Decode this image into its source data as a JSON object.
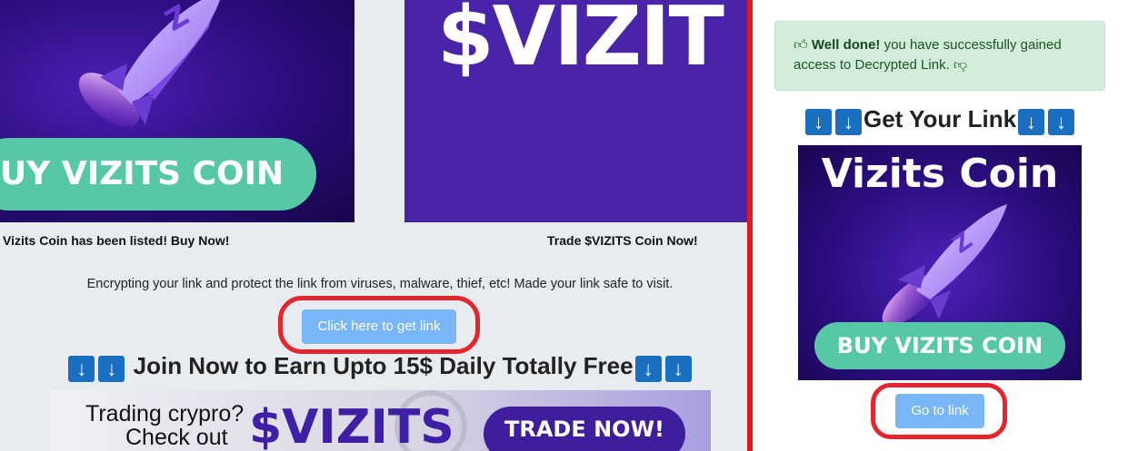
{
  "left": {
    "banner1": {
      "pill_label": "UY VIZITS COIN"
    },
    "banner2": {
      "logo_text": "$VIZIT"
    },
    "caption1": "Vizits Coin has been listed! Buy Now!",
    "caption2": "Trade $VIZITS Coin Now!",
    "description": "Encrypting your link and protect the link from viruses, malware, thief, etc! Made your link safe to visit.",
    "get_link_button": "Click here to get link",
    "join_title": "Join Now to Earn Upto 15$ Daily Totally Free",
    "trade_banner": {
      "line1": "Trading crypro?",
      "line2": "Check out",
      "brand": "$VIZITS",
      "button": "TRADE NOW!"
    }
  },
  "right": {
    "alert": {
      "strong": "Well done!",
      "text": " you have successfully gained access to Decrypted Link."
    },
    "get_link_title": "Get Your Link",
    "card": {
      "title": "Vizits Coin",
      "pill_label": "BUY VIZITS COIN"
    },
    "go_button": "Go to link"
  },
  "arrow_glyph": "↓",
  "colors": {
    "accent_red": "#e0191f",
    "button_blue": "#78b6f5",
    "coin_green": "#57c8a6",
    "brand_purple": "#4a24a8",
    "alert_green": "#d4ecda"
  },
  "icons": [
    "thumbs-up-icon",
    "thumbs-down-icon",
    "arrow-down-icon",
    "rocket-icon"
  ]
}
